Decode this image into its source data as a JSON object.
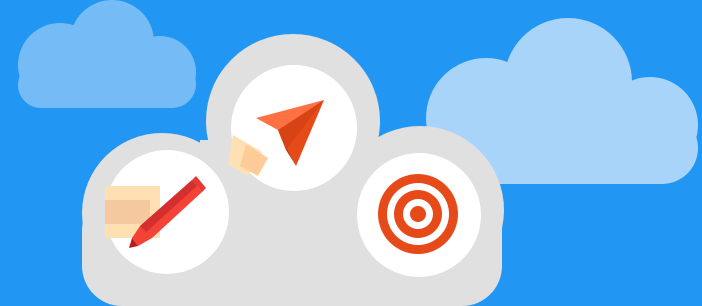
{
  "scene": {
    "background_color": "#2196F3",
    "cloud_light_color": "#75BCF6",
    "cloud_pale_color": "#A8D4FA",
    "cloud_grey_color": "#E0E0E0",
    "circle_color": "#FFFFFF"
  },
  "icons": [
    {
      "name": "pencil-icon",
      "colors": [
        "#F44336",
        "#D32F2F",
        "#FFE0B2",
        "#F5C9A0"
      ]
    },
    {
      "name": "paper-plane-icon",
      "colors": [
        "#E64A19",
        "#FF7043",
        "#BF360C",
        "#FFCC99"
      ]
    },
    {
      "name": "target-icon",
      "colors": [
        "#E64A19",
        "#FFFFFF"
      ]
    }
  ]
}
